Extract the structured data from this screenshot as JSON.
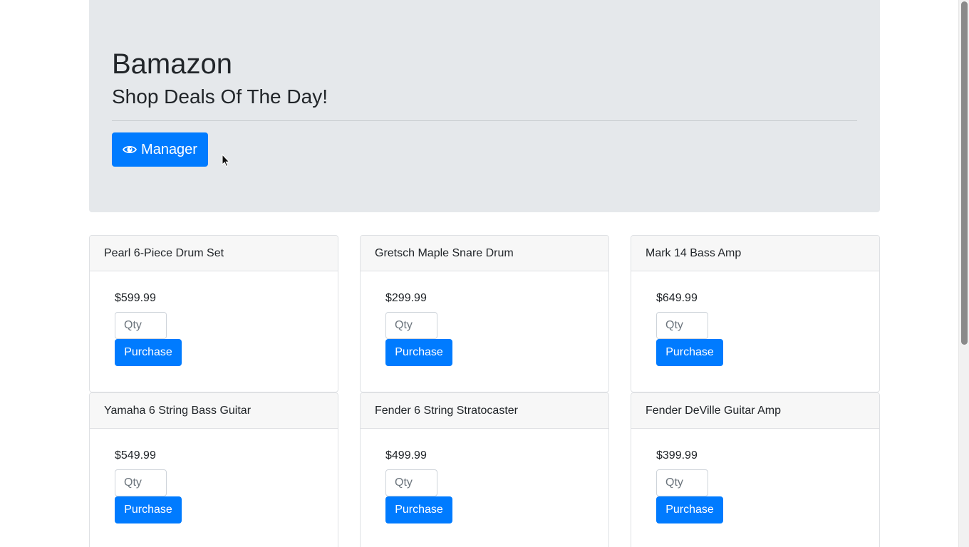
{
  "header": {
    "title": "Bamazon",
    "tagline": "Shop Deals Of The Day!",
    "manager_label": "Manager",
    "manager_icon": "eye-icon"
  },
  "products": [
    {
      "name": "Pearl 6-Piece Drum Set",
      "price": "$599.99",
      "qty_placeholder": "Qty",
      "button": "Purchase"
    },
    {
      "name": "Gretsch Maple Snare Drum",
      "price": "$299.99",
      "qty_placeholder": "Qty",
      "button": "Purchase"
    },
    {
      "name": "Mark 14 Bass Amp",
      "price": "$649.99",
      "qty_placeholder": "Qty",
      "button": "Purchase"
    },
    {
      "name": "Yamaha 6 String Bass Guitar",
      "price": "$549.99",
      "qty_placeholder": "Qty",
      "button": "Purchase"
    },
    {
      "name": "Fender 6 String Stratocaster",
      "price": "$499.99",
      "qty_placeholder": "Qty",
      "button": "Purchase"
    },
    {
      "name": "Fender DeVille Guitar Amp",
      "price": "$399.99",
      "qty_placeholder": "Qty",
      "button": "Purchase"
    }
  ],
  "colors": {
    "primary": "#007bff",
    "jumbotron_bg": "#e5e8eb",
    "card_header_bg": "#f7f7f7"
  }
}
